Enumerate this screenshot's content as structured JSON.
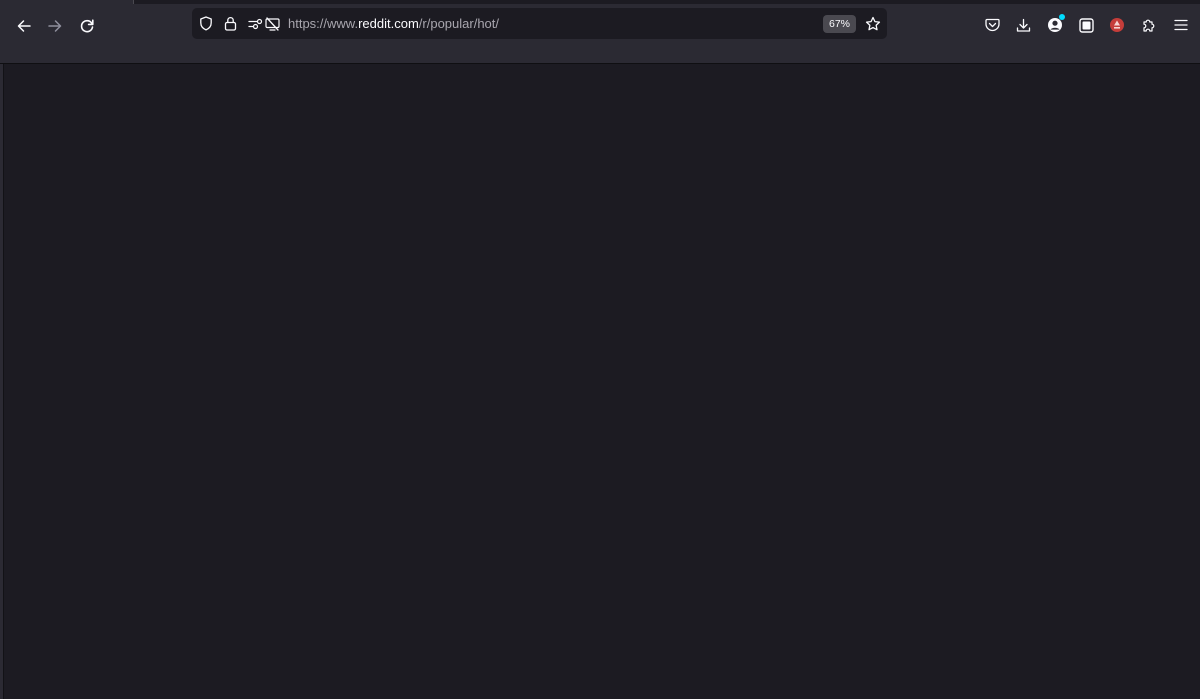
{
  "browser": {
    "url": {
      "scheme_prefix": "https://www.",
      "host": "reddit.com",
      "path": "/r/popular/hot/"
    },
    "zoom_label": "67%",
    "colors": {
      "toolbar": "#2b2a33",
      "urlbar": "#1c1b22",
      "content": "#1c1b22",
      "icon": "#fbfbfe",
      "disabled_icon": "#8f8f9d",
      "account_badge": "#00ddff",
      "extension_red": "#c53d3a"
    },
    "icons": {
      "back": "back-arrow-icon",
      "forward": "forward-arrow-icon",
      "reload": "reload-icon",
      "tracking": "shield-icon",
      "lock": "lock-icon",
      "permissions": "permissions-icon",
      "screen_share_blocked": "screen-share-blocked-icon",
      "bookmark": "star-icon",
      "pocket": "pocket-icon",
      "downloads": "download-icon",
      "account": "account-icon",
      "container": "container-icon",
      "extension": "extension-red-icon",
      "extensions": "puzzle-icon",
      "menu": "hamburger-menu-icon"
    }
  }
}
